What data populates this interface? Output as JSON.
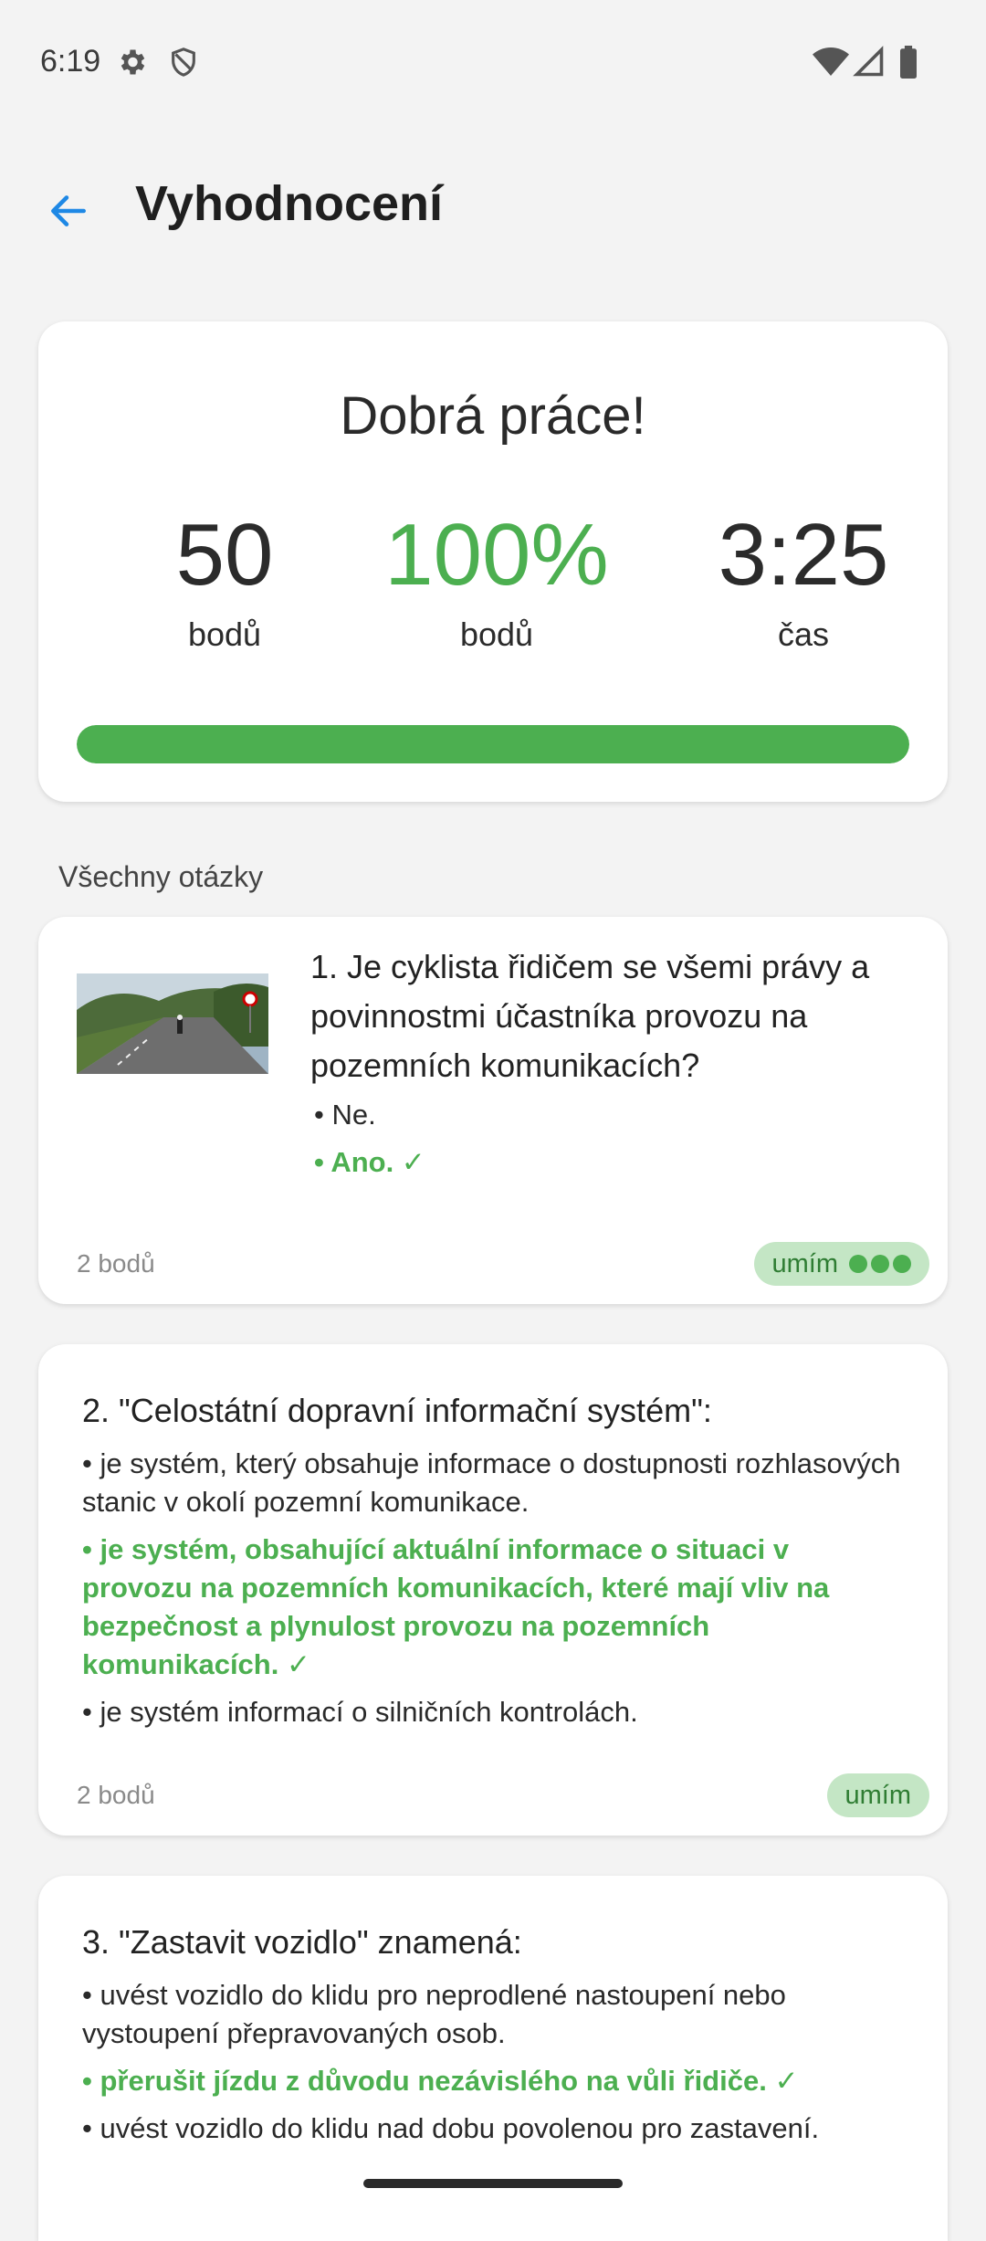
{
  "status_bar": {
    "time": "6:19",
    "icons": [
      "settings-icon",
      "shield-icon",
      "wifi-icon",
      "signal-icon",
      "battery-icon"
    ]
  },
  "app_bar": {
    "title": "Vyhodnocení",
    "back_icon": "arrow-back-icon"
  },
  "summary": {
    "headline": "Dobrá práce!",
    "stats": [
      {
        "value": "50",
        "label": "bodů"
      },
      {
        "value": "100%",
        "label": "bodů"
      },
      {
        "value": "3:25",
        "label": "čas"
      }
    ],
    "progress_fraction": 1.0
  },
  "section_title": "Všechny otázky",
  "questions": [
    {
      "text": "1. Je cyklista řidičem se všemi právy a povinnostmi účastníka provozu na pozemních komunikacích?",
      "answers": [
        "• Ne.",
        "• Ano. ✓"
      ],
      "points": "2 bodů",
      "badge": "umím"
    },
    {
      "text": "2. \"Celostátní dopravní informační systém\":",
      "answers": [
        "• je systém, který obsahuje informace o dostupnosti rozhlasových stanic v okolí pozemní komunikace.",
        "• je systém, obsahující aktuální informace o situaci v provozu na pozemních komunikacích, které mají vliv na bezpečnost a plynulost provozu na pozemních komunikacích. ✓",
        "• je systém informací o silničních kontrolách."
      ],
      "points": "2 bodů",
      "badge": "umím"
    },
    {
      "text": "3. \"Zastavit vozidlo\" znamená:",
      "answers": [
        "• uvést vozidlo do klidu pro neprodlené nastoupení nebo vystoupení přepravovaných osob.",
        "• přerušit jízdu z důvodu nezávislého na vůli řidiče. ✓",
        "• uvést vozidlo do klidu nad dobu povolenou pro zastavení."
      ]
    }
  ],
  "colors": {
    "accent_green": "#4caf50",
    "back_arrow": "#1e88e5",
    "badge_bg": "#c4e6c5"
  }
}
